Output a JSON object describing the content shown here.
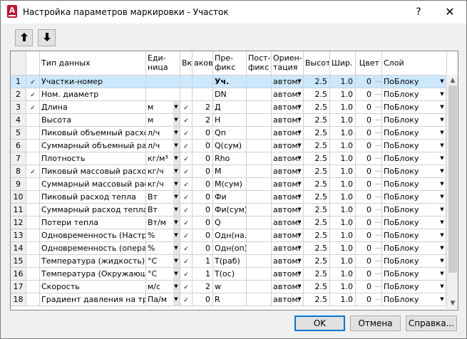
{
  "window": {
    "title": "Настройка параметров маркировки - Участок",
    "app_icon_letter": "A",
    "help_label": "?",
    "close_label": "✕"
  },
  "toolbar": {
    "move_up_label": "🠕",
    "move_down_label": "🠗"
  },
  "columns": {
    "data_type": "Тип данных",
    "unit": "Еди-\nница",
    "include": "Вкл",
    "decimals": "аков",
    "prefix": "Пре-\nфикс",
    "postfix": "Пост-\nфикс",
    "orientation": "Ориен-\nтация",
    "height": "Высот",
    "width": "Шир.",
    "color": "Цвет",
    "layer": "Слой"
  },
  "rows": [
    {
      "n": "1",
      "mark": "✓",
      "type": "Участки-номер",
      "unit": "",
      "unit_dd": false,
      "inc": "",
      "dec": "",
      "prefix": "Уч.",
      "prefix_bold": true,
      "postfix": "",
      "orient": "автом.",
      "h": "2.5",
      "w": "1.0",
      "color": "0",
      "layer": "ПоБлоку",
      "selected": true
    },
    {
      "n": "2",
      "mark": "✓",
      "type": "Ном. диаметр",
      "unit": "",
      "unit_dd": false,
      "inc": "",
      "dec": "",
      "prefix": "DN",
      "postfix": "",
      "orient": "автом.",
      "h": "2.5",
      "w": "1.0",
      "color": "0",
      "layer": "ПоБлоку"
    },
    {
      "n": "3",
      "mark": "✓",
      "type": "Длина",
      "unit": "м",
      "unit_dd": true,
      "inc": "✓",
      "dec": "2",
      "prefix": "Д",
      "postfix": "",
      "orient": "автом.",
      "h": "2.5",
      "w": "1.0",
      "color": "0",
      "layer": "ПоБлоку"
    },
    {
      "n": "4",
      "mark": "",
      "type": "Высота",
      "unit": "м",
      "unit_dd": true,
      "inc": "✓",
      "dec": "2",
      "prefix": "H",
      "postfix": "",
      "orient": "автом.",
      "h": "2.5",
      "w": "1.0",
      "color": "0",
      "layer": "ПоБлоку"
    },
    {
      "n": "5",
      "mark": "",
      "type": "Пиковый объемный расход",
      "unit": "л/ч",
      "unit_dd": true,
      "inc": "✓",
      "dec": "0",
      "prefix": "Qп",
      "postfix": "",
      "orient": "автом.",
      "h": "2.5",
      "w": "1.0",
      "color": "0",
      "layer": "ПоБлоку"
    },
    {
      "n": "6",
      "mark": "",
      "type": "Суммарный объемный рас…",
      "unit": "л/ч",
      "unit_dd": true,
      "inc": "✓",
      "dec": "0",
      "prefix": "Q(сум)",
      "postfix": "",
      "orient": "автом.",
      "h": "2.5",
      "w": "1.0",
      "color": "0",
      "layer": "ПоБлоку"
    },
    {
      "n": "7",
      "mark": "",
      "type": "Плотность",
      "unit": "кг/м³",
      "unit_dd": true,
      "inc": "✓",
      "dec": "0",
      "prefix": "Rho",
      "postfix": "",
      "orient": "автом.",
      "h": "2.5",
      "w": "1.0",
      "color": "0",
      "layer": "ПоБлоку"
    },
    {
      "n": "8",
      "mark": "✓",
      "type": "Пиковый массовый расход",
      "unit": "кг/ч",
      "unit_dd": true,
      "inc": "✓",
      "dec": "0",
      "prefix": "М",
      "postfix": "",
      "orient": "автом.",
      "h": "2.5",
      "w": "1.0",
      "color": "0",
      "layer": "ПоБлоку"
    },
    {
      "n": "9",
      "mark": "",
      "type": "Суммарный массовый рас…",
      "unit": "кг/ч",
      "unit_dd": true,
      "inc": "✓",
      "dec": "0",
      "prefix": "М(сум)",
      "postfix": "",
      "orient": "автом.",
      "h": "2.5",
      "w": "1.0",
      "color": "0",
      "layer": "ПоБлоку"
    },
    {
      "n": "10",
      "mark": "",
      "type": "Пиковый расход тепла",
      "unit": "Вт",
      "unit_dd": true,
      "inc": "✓",
      "dec": "0",
      "prefix": "Фи",
      "postfix": "",
      "orient": "автом.",
      "h": "2.5",
      "w": "1.0",
      "color": "0",
      "layer": "ПоБлоку"
    },
    {
      "n": "11",
      "mark": "",
      "type": "Суммарный расход тепла",
      "unit": "Вт",
      "unit_dd": true,
      "inc": "✓",
      "dec": "0",
      "prefix": "Фи(сум)",
      "postfix": "",
      "orient": "автом.",
      "h": "2.5",
      "w": "1.0",
      "color": "0",
      "layer": "ПоБлоку"
    },
    {
      "n": "12",
      "mark": "",
      "type": "Потери тепла",
      "unit": "Вт/м",
      "unit_dd": true,
      "inc": "✓",
      "dec": "0",
      "prefix": "Q",
      "postfix": "",
      "orient": "автом.",
      "h": "2.5",
      "w": "1.0",
      "color": "0",
      "layer": "ПоБлоку"
    },
    {
      "n": "13",
      "mark": "",
      "type": "Одновременность (Настро…",
      "unit": "%",
      "unit_dd": true,
      "inc": "✓",
      "dec": "0",
      "prefix": "Одн(на…",
      "postfix": "",
      "orient": "автом.",
      "h": "2.5",
      "w": "1.0",
      "color": "0",
      "layer": "ПоБлоку"
    },
    {
      "n": "14",
      "mark": "",
      "type": "Одновременность (операт…",
      "unit": "%",
      "unit_dd": true,
      "inc": "✓",
      "dec": "0",
      "prefix": "Одн(оп)",
      "postfix": "",
      "orient": "автом.",
      "h": "2.5",
      "w": "1.0",
      "color": "0",
      "layer": "ПоБлоку"
    },
    {
      "n": "15",
      "mark": "",
      "type": "Температура (жидкость)",
      "unit": "°C",
      "unit_dd": true,
      "inc": "✓",
      "dec": "1",
      "prefix": "T(раб)",
      "postfix": "",
      "orient": "автом.",
      "h": "2.5",
      "w": "1.0",
      "color": "0",
      "layer": "ПоБлоку"
    },
    {
      "n": "16",
      "mark": "",
      "type": "Температура (Окружающа…",
      "unit": "°C",
      "unit_dd": true,
      "inc": "✓",
      "dec": "1",
      "prefix": "T(ос)",
      "postfix": "",
      "orient": "автом.",
      "h": "2.5",
      "w": "1.0",
      "color": "0",
      "layer": "ПоБлоку"
    },
    {
      "n": "17",
      "mark": "",
      "type": "Скорость",
      "unit": "м/с",
      "unit_dd": true,
      "inc": "✓",
      "dec": "2",
      "prefix": "w",
      "postfix": "",
      "orient": "автом.",
      "h": "2.5",
      "w": "1.0",
      "color": "0",
      "layer": "ПоБлоку"
    },
    {
      "n": "18",
      "mark": "",
      "type": "Градиент давления на тре…",
      "unit": "Па/м",
      "unit_dd": true,
      "inc": "✓",
      "dec": "0",
      "prefix": "R",
      "postfix": "",
      "orient": "автом.",
      "h": "2.5",
      "w": "1.0",
      "color": "0",
      "layer": "ПоБлоку"
    }
  ],
  "buttons": {
    "ok": "OK",
    "cancel": "Отмена",
    "help": "Справка..."
  },
  "colors": {
    "selection": "#cce8ff",
    "app_icon": "#c8102e",
    "default_button_border": "#0078d7"
  }
}
